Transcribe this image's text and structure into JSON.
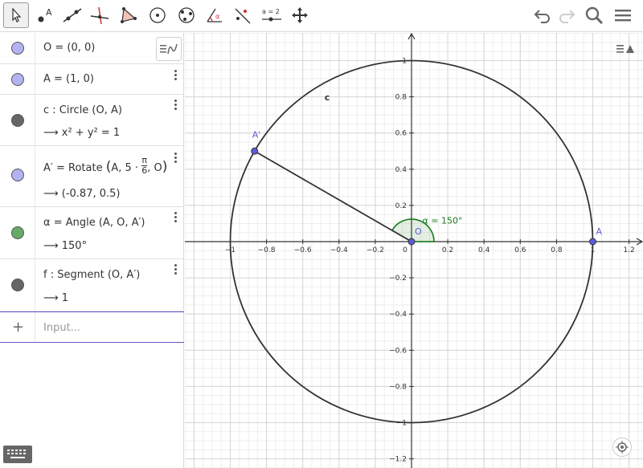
{
  "toolbar": {
    "tools": [
      {
        "name": "move-tool",
        "active": true
      },
      {
        "name": "point-tool"
      },
      {
        "name": "line-tool"
      },
      {
        "name": "perpendicular-line-tool"
      },
      {
        "name": "polygon-tool"
      },
      {
        "name": "circle-center-point-tool"
      },
      {
        "name": "circle-three-points-tool"
      },
      {
        "name": "angle-tool"
      },
      {
        "name": "reflect-tool"
      },
      {
        "name": "slider-tool",
        "label": "a = 2"
      },
      {
        "name": "move-graphics-view-tool"
      }
    ],
    "right_buttons": [
      "undo-icon",
      "redo-icon",
      "search-icon",
      "menu-icon"
    ]
  },
  "algebra": {
    "rows": [
      {
        "name": "O",
        "text": "O = (0, 0)",
        "color": "#b3b3f2"
      },
      {
        "name": "A",
        "text": "A = (1, 0)",
        "color": "#b3b3f2"
      },
      {
        "name": "c",
        "text": "c : Circle (O, A)",
        "output": "⟶  x² + y² = 1",
        "color": "#666666"
      },
      {
        "name": "A-prime",
        "text_prefix": "A′ = Rotate",
        "text_args_a": "A, 5 ·",
        "frac_num": "π",
        "frac_den": "6",
        "text_args_b": ", O",
        "output": "⟶  (-0.87, 0.5)",
        "color": "#b3b3f2"
      },
      {
        "name": "alpha",
        "text": "α = Angle (A, O, A′)",
        "output": "⟶  150°",
        "color": "#66aa66"
      },
      {
        "name": "f",
        "text": "f : Segment (O, A′)",
        "output": "⟶  1",
        "color": "#666666"
      }
    ],
    "input_placeholder": "Input..."
  },
  "graphics": {
    "x_ticks": [
      "−1",
      "−0.8",
      "−0.6",
      "−0.4",
      "−0.2",
      "0",
      "0.2",
      "0.4",
      "0.6",
      "0.8",
      "1",
      "1.2"
    ],
    "y_ticks": [
      "1",
      "0.8",
      "0.6",
      "0.4",
      "0.2",
      "−0.2",
      "−0.4",
      "−0.6",
      "−0.8",
      "−1",
      "−1.2"
    ],
    "labels": {
      "circle": "c",
      "point_A_prime": "A'",
      "point_O": "O",
      "point_A": "A",
      "angle": "α = 150°"
    },
    "colors": {
      "point": "#5c5cd6",
      "angle": "#1a7a1a",
      "object": "#333333",
      "axis": "#333333"
    }
  }
}
